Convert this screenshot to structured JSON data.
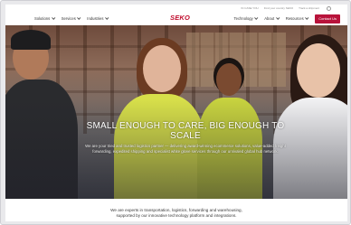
{
  "utility_bar": {
    "links": [
      "IN CASE YOU",
      "Find your country SEKO",
      "Track a shipment"
    ]
  },
  "nav": {
    "left_items": [
      "Solutions",
      "Services",
      "Industries"
    ],
    "logo": {
      "primary": "SEKO",
      "tm": ""
    },
    "right_items": [
      "Technology",
      "About",
      "Resources"
    ],
    "cta_label": "Contact Us"
  },
  "hero": {
    "title": "SMALL ENOUGH TO CARE, BIG ENOUGH TO SCALE",
    "body": "We are your tried and trusted logistics partner — delivering award-winning ecommerce solutions, value-added freight forwarding, expedited shipping and specialist white glove services through our unrivaled global hub network."
  },
  "intro": {
    "text_line1": "We are experts in transportation, logistics, forwarding and warehousing,",
    "text_line2": "supported by our innovative technology platform and integrations."
  },
  "colors": {
    "brand": "#c00b2b",
    "cta": "#b8133b"
  }
}
